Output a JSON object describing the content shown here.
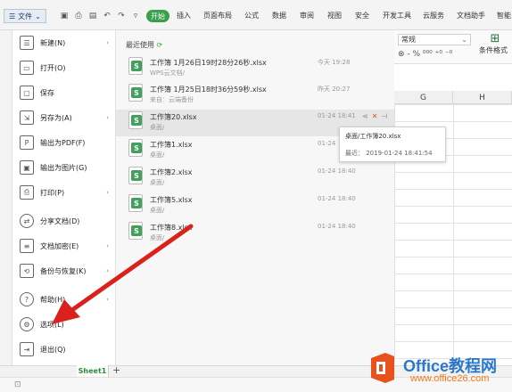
{
  "colors": {
    "accent": "#39a04a",
    "arrow": "#d9221c",
    "highlight_row": "#e6e6e6",
    "watermark_blue": "#2c77c9",
    "watermark_orange": "#f27a1a"
  },
  "titlebar": {
    "file_menu": "文件",
    "tabs": [
      "开始",
      "插入",
      "页面布局",
      "公式",
      "数据",
      "审阅",
      "视图",
      "安全",
      "开发工具",
      "云服务",
      "文档助手",
      "智能"
    ]
  },
  "ribbon_right": {
    "format_value": "常规",
    "number_symbols": "⊗ - % ⁰⁰⁰ ⁺⁰ ⁻⁰",
    "cond_format_label": "条件格式"
  },
  "grid": {
    "columns": [
      "G",
      "H"
    ]
  },
  "file_menu": {
    "items": [
      {
        "label": "新建(N)",
        "icon": "new-doc-icon",
        "glyph": "☰",
        "has_submenu": true
      },
      {
        "label": "打开(O)",
        "icon": "open-folder-icon",
        "glyph": "▭",
        "has_submenu": false
      },
      {
        "label": "保存",
        "icon": "save-icon",
        "glyph": "▢",
        "has_submenu": false
      },
      {
        "label": "另存为(A)",
        "icon": "save-as-icon",
        "glyph": "⇲",
        "has_submenu": true
      },
      {
        "label": "输出为PDF(F)",
        "icon": "pdf-icon",
        "glyph": "P",
        "has_submenu": false
      },
      {
        "label": "输出为图片(G)",
        "icon": "image-icon",
        "glyph": "▣",
        "has_submenu": false
      },
      {
        "label": "打印(P)",
        "icon": "print-icon",
        "glyph": "⎙",
        "has_submenu": true
      },
      {
        "label": "分享文档(D)",
        "icon": "share-icon",
        "glyph": "⇄",
        "has_submenu": false
      },
      {
        "label": "文档加密(E)",
        "icon": "encrypt-icon",
        "glyph": "≡",
        "has_submenu": true
      },
      {
        "label": "备份与恢复(K)",
        "icon": "backup-icon",
        "glyph": "⟲",
        "has_submenu": true
      },
      {
        "label": "帮助(H)",
        "icon": "help-icon",
        "glyph": "?",
        "has_submenu": true
      },
      {
        "label": "选项(L)",
        "icon": "gear-icon",
        "glyph": "⚙",
        "has_submenu": false
      },
      {
        "label": "退出(Q)",
        "icon": "exit-icon",
        "glyph": "⇥",
        "has_submenu": false
      }
    ]
  },
  "recent": {
    "title": "最近使用",
    "files": [
      {
        "name": "工作簿 1月26日19时28分26秒.xlsx",
        "path": "WPS云文档/",
        "time": "今天 19:28"
      },
      {
        "name": "工作簿 1月25日18时36分59秒.xlsx",
        "path": "来自：云端备份",
        "time": "昨天 20:27"
      },
      {
        "name": "工作簿20.xlsx",
        "path": "桌面/",
        "time": "01-24 18:41"
      },
      {
        "name": "工作簿1.xlsx",
        "path": "桌面/",
        "time": "01-24"
      },
      {
        "name": "工作簿2.xlsx",
        "path": "桌面/",
        "time": "01-24 18:40"
      },
      {
        "name": "工作簿5.xlsx",
        "path": "桌面/",
        "time": "01-24 18:40"
      },
      {
        "name": "工作簿8.xlsx",
        "path": "桌面/",
        "time": "01-24 18:40"
      }
    ]
  },
  "tooltip": {
    "path": "桌面/工作簿20.xlsx",
    "recent": "最近：  2019-01-24 18:41:54"
  },
  "sheets": {
    "active": "Sheet1",
    "add": "+"
  },
  "watermark": {
    "title": "Office教程网",
    "url": "www.office26.com"
  }
}
